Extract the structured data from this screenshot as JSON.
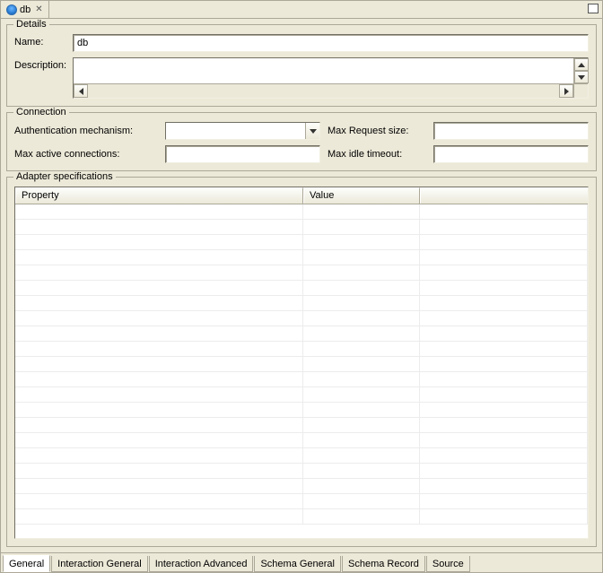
{
  "editor_tab": {
    "title": "db"
  },
  "details": {
    "legend": "Details",
    "name_label": "Name:",
    "name_value": "db",
    "description_label": "Description:",
    "description_value": ""
  },
  "connection": {
    "legend": "Connection",
    "auth_label": "Authentication mechanism:",
    "auth_value": "",
    "max_request_label": "Max Request size:",
    "max_request_value": "",
    "max_conn_label": "Max active connections:",
    "max_conn_value": "",
    "max_idle_label": "Max idle timeout:",
    "max_idle_value": ""
  },
  "adapter": {
    "legend": "Adapter specifications",
    "columns": {
      "property": "Property",
      "value": "Value"
    },
    "rows": []
  },
  "bottom_tabs": [
    {
      "label": "General",
      "active": true
    },
    {
      "label": "Interaction General",
      "active": false
    },
    {
      "label": "Interaction Advanced",
      "active": false
    },
    {
      "label": "Schema General",
      "active": false
    },
    {
      "label": "Schema Record",
      "active": false
    },
    {
      "label": "Source",
      "active": false
    }
  ]
}
